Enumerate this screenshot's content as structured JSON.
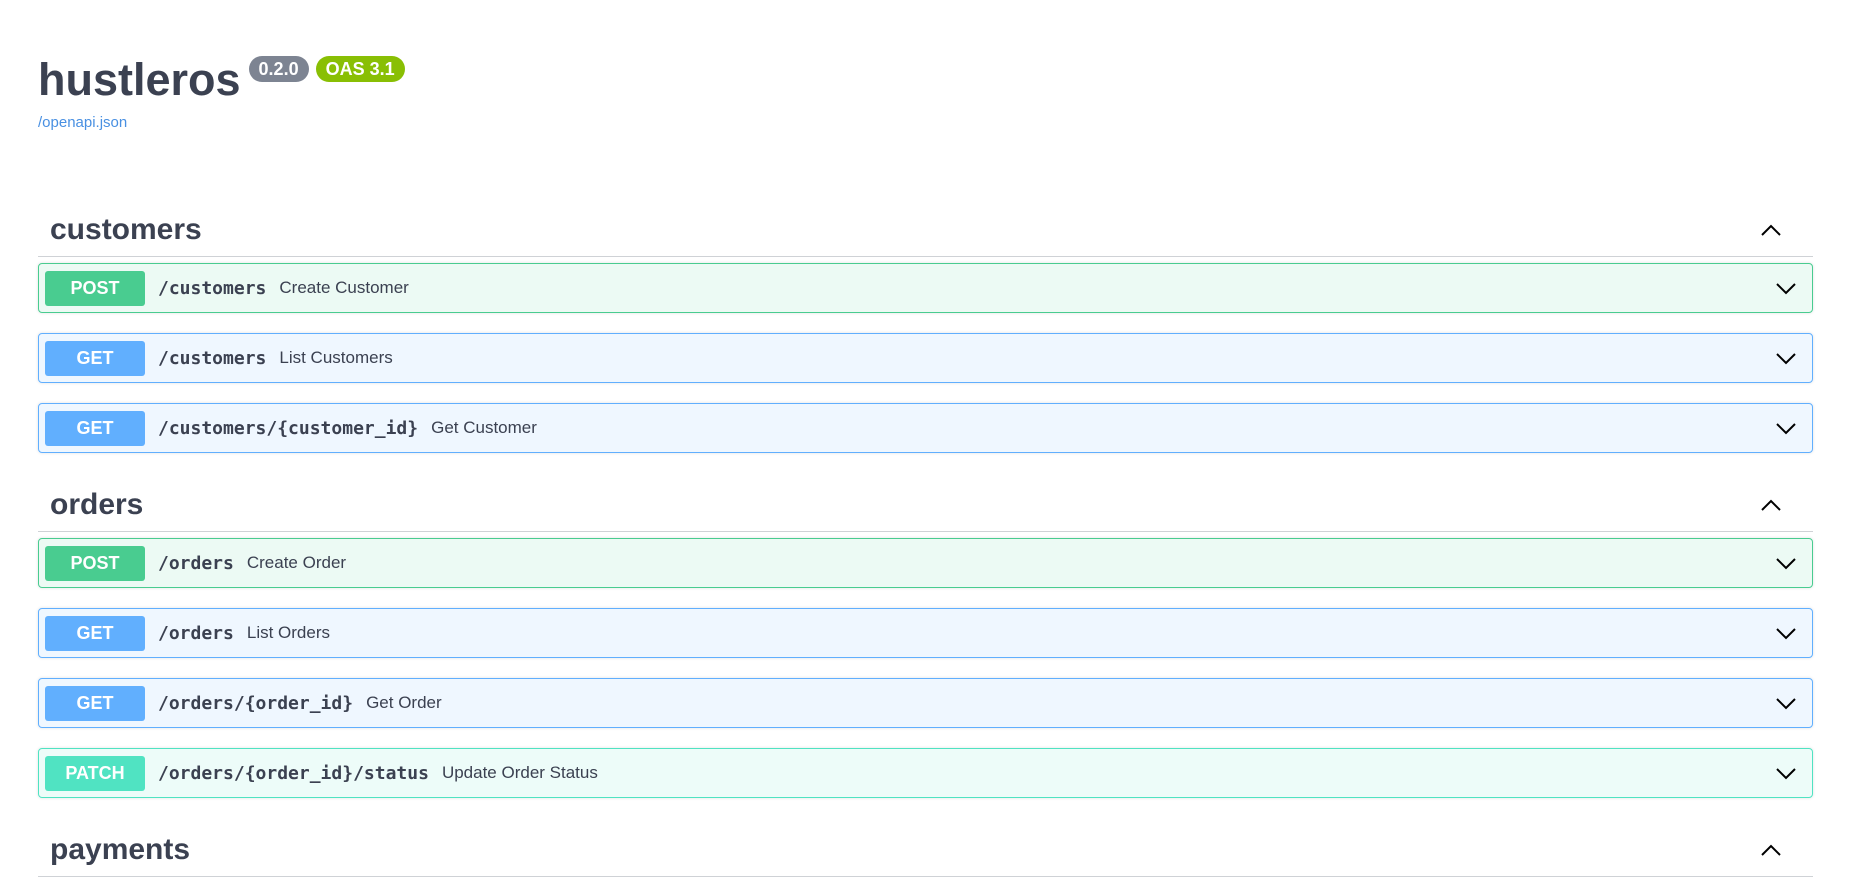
{
  "info": {
    "title": "hustleros",
    "version": "0.2.0",
    "oas": "OAS 3.1",
    "spec_link": "/openapi.json"
  },
  "colors": {
    "post": "#49cc90",
    "get": "#61affe",
    "patch": "#50e3c2",
    "version_badge": "#7d8492",
    "oas_badge": "#89bf04",
    "link": "#4990e2"
  },
  "icons": {
    "tag_toggle": "chevron-up-icon",
    "op_toggle": "chevron-down-icon"
  },
  "tags": [
    {
      "name": "customers",
      "expanded": true,
      "operations": [
        {
          "method": "POST",
          "path": "/customers",
          "summary": "Create Customer"
        },
        {
          "method": "GET",
          "path": "/customers",
          "summary": "List Customers"
        },
        {
          "method": "GET",
          "path": "/customers/{customer_id}",
          "summary": "Get Customer"
        }
      ]
    },
    {
      "name": "orders",
      "expanded": true,
      "operations": [
        {
          "method": "POST",
          "path": "/orders",
          "summary": "Create Order"
        },
        {
          "method": "GET",
          "path": "/orders",
          "summary": "List Orders"
        },
        {
          "method": "GET",
          "path": "/orders/{order_id}",
          "summary": "Get Order"
        },
        {
          "method": "PATCH",
          "path": "/orders/{order_id}/status",
          "summary": "Update Order Status"
        }
      ]
    },
    {
      "name": "payments",
      "expanded": true,
      "operations": []
    }
  ]
}
